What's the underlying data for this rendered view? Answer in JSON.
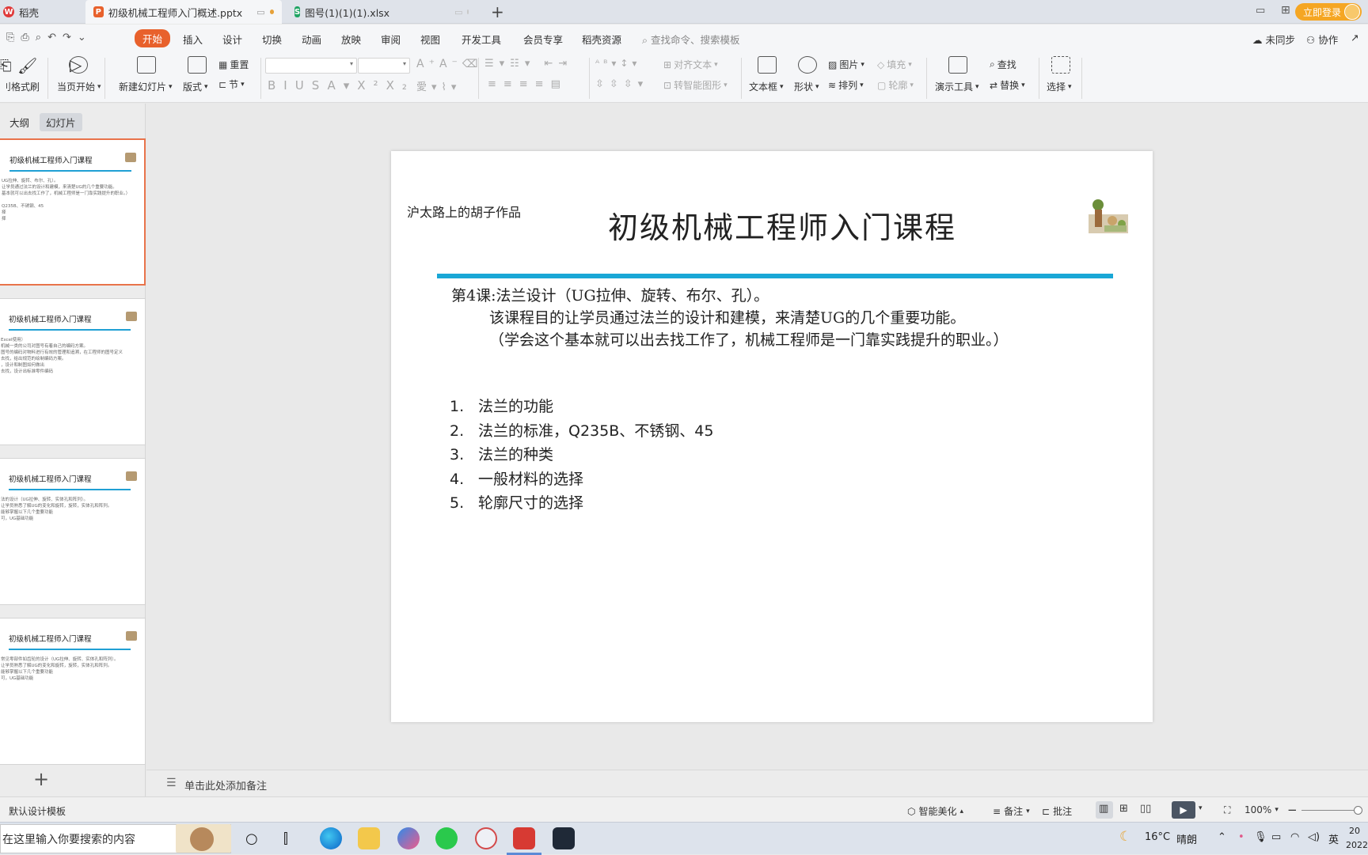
{
  "tabs": {
    "home": "稻壳",
    "pptx": "初级机械工程师入门概述.pptx",
    "xlsx": "图号(1)(1)(1).xlsx",
    "add": "+",
    "login": "立即登录"
  },
  "menu": {
    "start": "开始",
    "insert": "插入",
    "design": "设计",
    "transition": "切换",
    "animation": "动画",
    "slideshow": "放映",
    "review": "审阅",
    "view": "视图",
    "devtools": "开发工具",
    "member": "会员专享",
    "resources": "稻壳资源",
    "search_placeholder": "查找命令、搜索模板",
    "sync": "未同步",
    "collab": "协作"
  },
  "ribbon": {
    "format_brush": "格式刷",
    "from_current": "当页开始",
    "new_slide": "新建幻灯片",
    "layout": "版式",
    "reset": "重置",
    "section": "节",
    "align_text": "对齐文本",
    "smart_shape": "转智能图形",
    "textbox": "文本框",
    "shape": "形状",
    "picture": "图片",
    "fill": "填充",
    "arrange": "排列",
    "outline": "轮廓",
    "present_tools": "演示工具",
    "find": "查找",
    "replace": "替换",
    "select": "选择"
  },
  "left_panel": {
    "outline_tab": "大纲",
    "slides_tab": "幻灯片",
    "thumbs": [
      {
        "title": "初级机械工程师入门课程",
        "lines": [
          "UG拉伸、旋转、布尔、孔）。",
          "让学员通过法兰的设计和建模，来清楚UG的几个重要功能。",
          "基本就可以出去找工作了，机械工程师是一门靠实践提升的职业。）",
          "",
          "Q235B、不锈钢、45",
          "择",
          "择"
        ]
      },
      {
        "title": "初级机械工程师入门课程",
        "lines": [
          "Excel使用）",
          "机械一类的公司对图号有着自己的编码方案。",
          "图号的编码对物料进行有效的管理和追溯，在工程师的图号定义",
          "去找，给出规范的绘制编码方案。",
          "，设计和制图如何做出",
          "去找，设计出标准零件编码"
        ]
      },
      {
        "title": "初级机械工程师入门课程",
        "lines": [
          "法的设计（UG拉伸、旋转、实体孔和阵列）。",
          "让学员熟悉了解UG的变化和旋转，旋转，实体孔和阵列。",
          "能够掌握以下几个重要功能",
          "可，UG基础功能"
        ]
      },
      {
        "title": "初级机械工程师入门课程",
        "lines": [
          "常见零部件如齿轮的设计（UG拉伸、旋转、实体孔和阵列）。",
          "让学员熟悉了解UG的变化和旋转，旋转，实体孔和阵列。",
          "能够掌握以下几个重要功能",
          "可，UG基础功能"
        ]
      }
    ],
    "add_slide": "+"
  },
  "slide": {
    "author": "沪太路上的胡子作品",
    "title": "初级机械工程师入门课程",
    "line1": "第4课:法兰设计（UG拉伸、旋转、布尔、孔）。",
    "line2": "该课程目的让学员通过法兰的设计和建模，来清楚UG的几个重要功能。",
    "line3": "（学会这个基本就可以出去找工作了，机械工程师是一门靠实践提升的职业。）",
    "list": [
      {
        "num": "1.",
        "text": "法兰的功能"
      },
      {
        "num": "2.",
        "text": "法兰的标准，Q235B、不锈钢、45"
      },
      {
        "num": "3.",
        "text": "法兰的种类"
      },
      {
        "num": "4.",
        "text": "一般材料的选择"
      },
      {
        "num": "5.",
        "text": "轮廓尺寸的选择"
      }
    ]
  },
  "notes": {
    "placeholder": "单击此处添加备注"
  },
  "status": {
    "template": "默认设计模板",
    "beautify": "智能美化",
    "notes": "备注",
    "comment": "批注",
    "zoom": "100%"
  },
  "taskbar": {
    "search_placeholder": "在这里输入你要搜索的内容",
    "weather_temp": "16°C",
    "weather_text": "晴朗",
    "ime": "英",
    "time": "20",
    "date": "2022"
  },
  "colors": {
    "accent": "#e8612c",
    "title_bar": "#19a7d6",
    "selected_thumb": "#e8734a",
    "login": "#f5a623"
  }
}
